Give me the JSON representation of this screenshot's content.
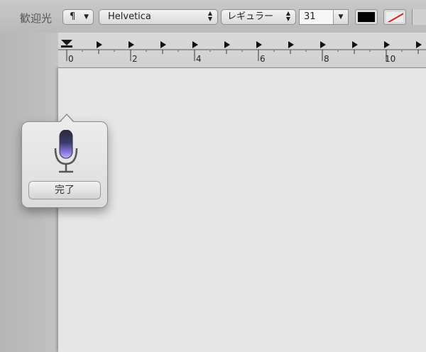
{
  "app": {
    "title_fragment": "歓迎光"
  },
  "toolbar": {
    "paragraph_symbol": "¶",
    "font_family": "Helvetica",
    "font_style": "レギュラー",
    "font_size": "31",
    "text_color": "#000000",
    "icons": {
      "paragraph_caret": "chevron-down-icon",
      "updown": "updown-chevron-icon",
      "size_drop": "triangle-down-icon",
      "background_none": "no-color-slash-icon"
    }
  },
  "ruler": {
    "labels": [
      "0",
      "2",
      "4",
      "6",
      "8",
      "10"
    ]
  },
  "dictation": {
    "done_label": "完了",
    "mic_icon": "microphone-icon"
  }
}
